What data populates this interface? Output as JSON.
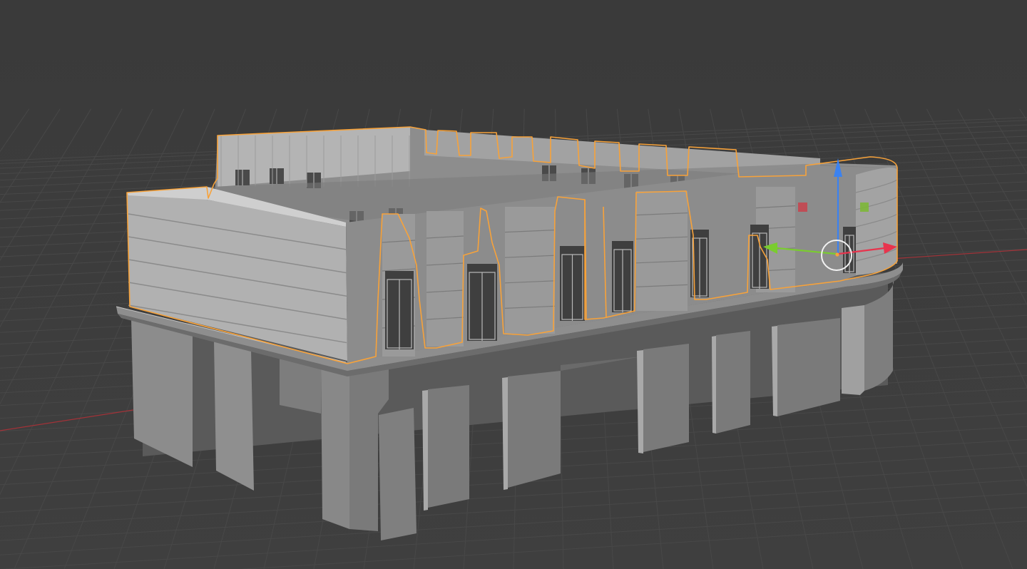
{
  "app": {
    "view": "3d-viewport",
    "shading": "solid",
    "scene_object": "building-upper-floor",
    "selection": "upper-floor-walls"
  },
  "colors": {
    "background": "#3d3d3d",
    "grid_line": "#474747",
    "x_axis": "#b0343a",
    "y_axis": "#6e8f2a",
    "selection_outline": "#f7a23a",
    "gizmo_x": "#e8344d",
    "gizmo_y": "#7acc2f",
    "gizmo_z": "#3b82f0",
    "gizmo_center": "#ffffff",
    "mesh_light": "#a7a7a7",
    "mesh_mid": "#8a8a8a",
    "mesh_dark": "#6f6f6f"
  },
  "icons": {
    "gizmo": "move-gizmo-icon",
    "origin": "object-origin-icon"
  }
}
